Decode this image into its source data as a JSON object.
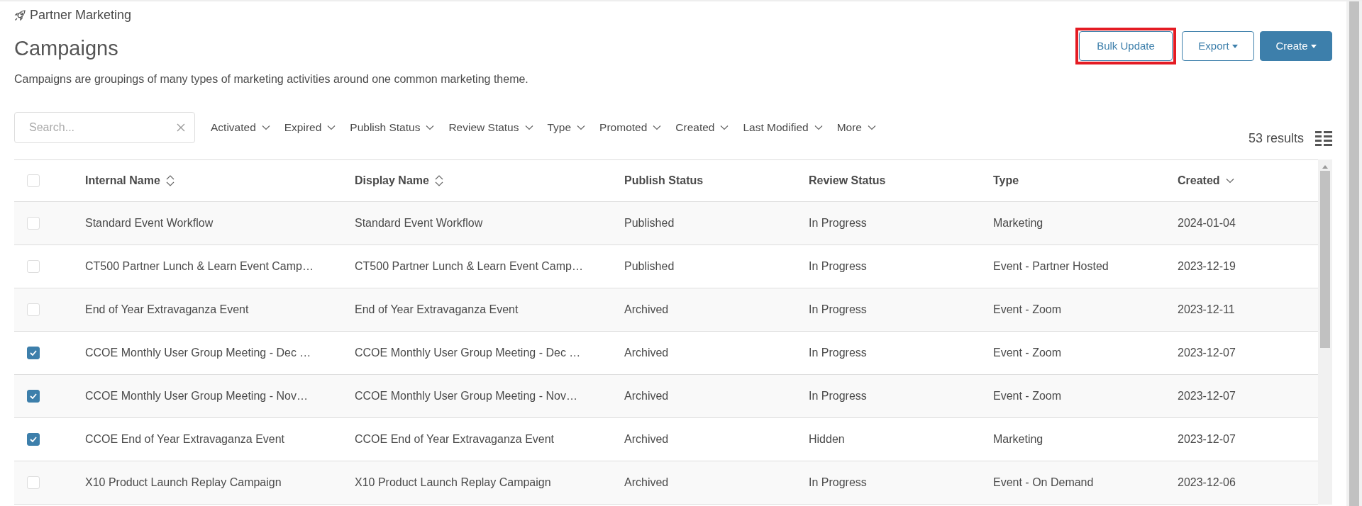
{
  "breadcrumb": "Partner Marketing",
  "title": "Campaigns",
  "description": "Campaigns are groupings of many types of marketing activities around one common marketing theme.",
  "actions": [
    {
      "label": "Bulk Update",
      "kind": "outline",
      "highlighted": true,
      "dropdown": false
    },
    {
      "label": "Export",
      "kind": "outline",
      "highlighted": false,
      "dropdown": true
    },
    {
      "label": "Create",
      "kind": "primary",
      "highlighted": false,
      "dropdown": true
    }
  ],
  "search": {
    "placeholder": "Search..."
  },
  "filters": [
    "Activated",
    "Expired",
    "Publish Status",
    "Review Status",
    "Type",
    "Promoted",
    "Created",
    "Last Modified",
    "More"
  ],
  "results": "53 results",
  "table": {
    "select_all_checked": false,
    "columns": [
      {
        "label": "Internal Name",
        "sortable": true,
        "sorted_desc": false
      },
      {
        "label": "Display Name",
        "sortable": true,
        "sorted_desc": false
      },
      {
        "label": "Publish Status",
        "sortable": false,
        "sorted_desc": false
      },
      {
        "label": "Review Status",
        "sortable": false,
        "sorted_desc": false
      },
      {
        "label": "Type",
        "sortable": false,
        "sorted_desc": false
      },
      {
        "label": "Created",
        "sortable": false,
        "sorted_desc": true
      }
    ],
    "rows": [
      {
        "checked": false,
        "cells": [
          "Standard Event Workflow",
          "Standard Event Workflow",
          "Published",
          "In Progress",
          "Marketing",
          "2024-01-04"
        ]
      },
      {
        "checked": false,
        "cells": [
          "CT500 Partner Lunch & Learn Event Camp…",
          "CT500 Partner Lunch & Learn Event Camp…",
          "Published",
          "In Progress",
          "Event - Partner Hosted",
          "2023-12-19"
        ]
      },
      {
        "checked": false,
        "cells": [
          "End of Year Extravaganza Event",
          "End of Year Extravaganza Event",
          "Archived",
          "In Progress",
          "Event - Zoom",
          "2023-12-11"
        ]
      },
      {
        "checked": true,
        "cells": [
          "CCOE Monthly User Group Meeting - Dec …",
          "CCOE Monthly User Group Meeting - Dec …",
          "Archived",
          "In Progress",
          "Event - Zoom",
          "2023-12-07"
        ]
      },
      {
        "checked": true,
        "cells": [
          "CCOE Monthly User Group Meeting - Nov…",
          "CCOE Monthly User Group Meeting - Nov…",
          "Archived",
          "In Progress",
          "Event - Zoom",
          "2023-12-07"
        ]
      },
      {
        "checked": true,
        "cells": [
          "CCOE End of Year Extravaganza Event",
          "CCOE End of Year Extravaganza Event",
          "Archived",
          "Hidden",
          "Marketing",
          "2023-12-07"
        ]
      },
      {
        "checked": false,
        "cells": [
          "X10 Product Launch Replay Campaign",
          "X10 Product Launch Replay Campaign",
          "Archived",
          "In Progress",
          "Event - On Demand",
          "2023-12-06"
        ]
      }
    ]
  }
}
